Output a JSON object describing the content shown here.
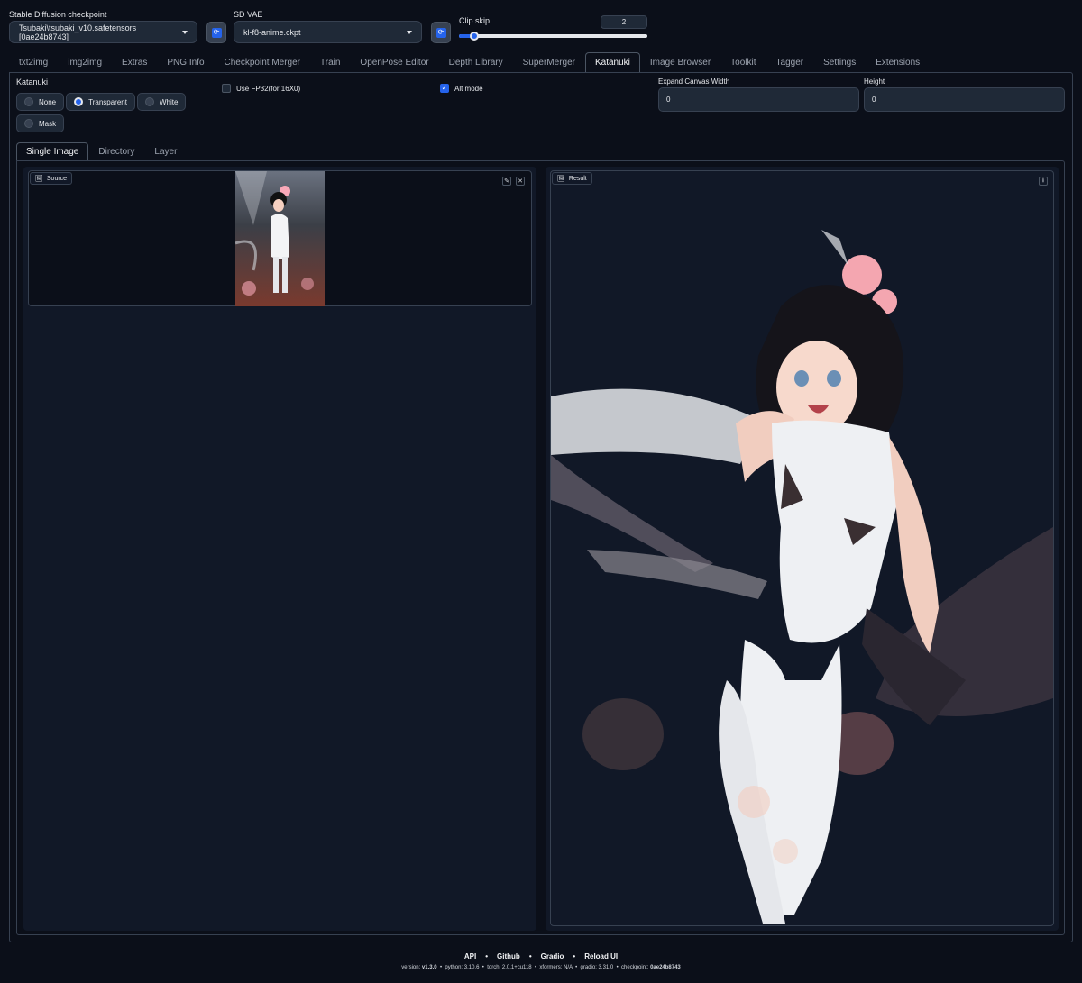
{
  "checkpoint": {
    "label": "Stable Diffusion checkpoint",
    "value": "Tsubaki\\tsubaki_v10.safetensors [0ae24b8743]"
  },
  "vae": {
    "label": "SD VAE",
    "value": "kl-f8-anime.ckpt"
  },
  "clip_skip": {
    "label": "Clip skip",
    "value": "2",
    "level_fraction": 0.083
  },
  "tabs": [
    "txt2img",
    "img2img",
    "Extras",
    "PNG Info",
    "Checkpoint Merger",
    "Train",
    "OpenPose Editor",
    "Depth Library",
    "SuperMerger",
    "Katanuki",
    "Image Browser",
    "Toolkit",
    "Tagger",
    "Settings",
    "Extensions"
  ],
  "active_tab": "Katanuki",
  "katanuki": {
    "label": "Katanuki",
    "options": [
      "None",
      "Transparent",
      "White",
      "Mask"
    ],
    "selected": "Transparent",
    "fp32_label": "Use FP32(for 16X0)",
    "alt_mode_label": "Alt mode",
    "expand_width_label": "Expand Canvas Width",
    "expand_width_value": "0",
    "height_label": "Height",
    "height_value": "0"
  },
  "subtabs": [
    "Single Image",
    "Directory",
    "Layer"
  ],
  "source_label": "Source",
  "result_label": "Result",
  "footer": {
    "links": [
      "API",
      "Github",
      "Gradio",
      "Reload UI"
    ],
    "version_label": "version:",
    "version": "v1.3.0",
    "python": "python: 3.10.6",
    "torch": "torch: 2.0.1+cu118",
    "xformers": "xformers: N/A",
    "gradio": "gradio: 3.31.0",
    "checkpoint_label": "checkpoint:",
    "checkpoint": "0ae24b8743"
  },
  "colors": {
    "accent": "#2563eb",
    "background": "#0b0f19",
    "panel": "#1f2937"
  }
}
